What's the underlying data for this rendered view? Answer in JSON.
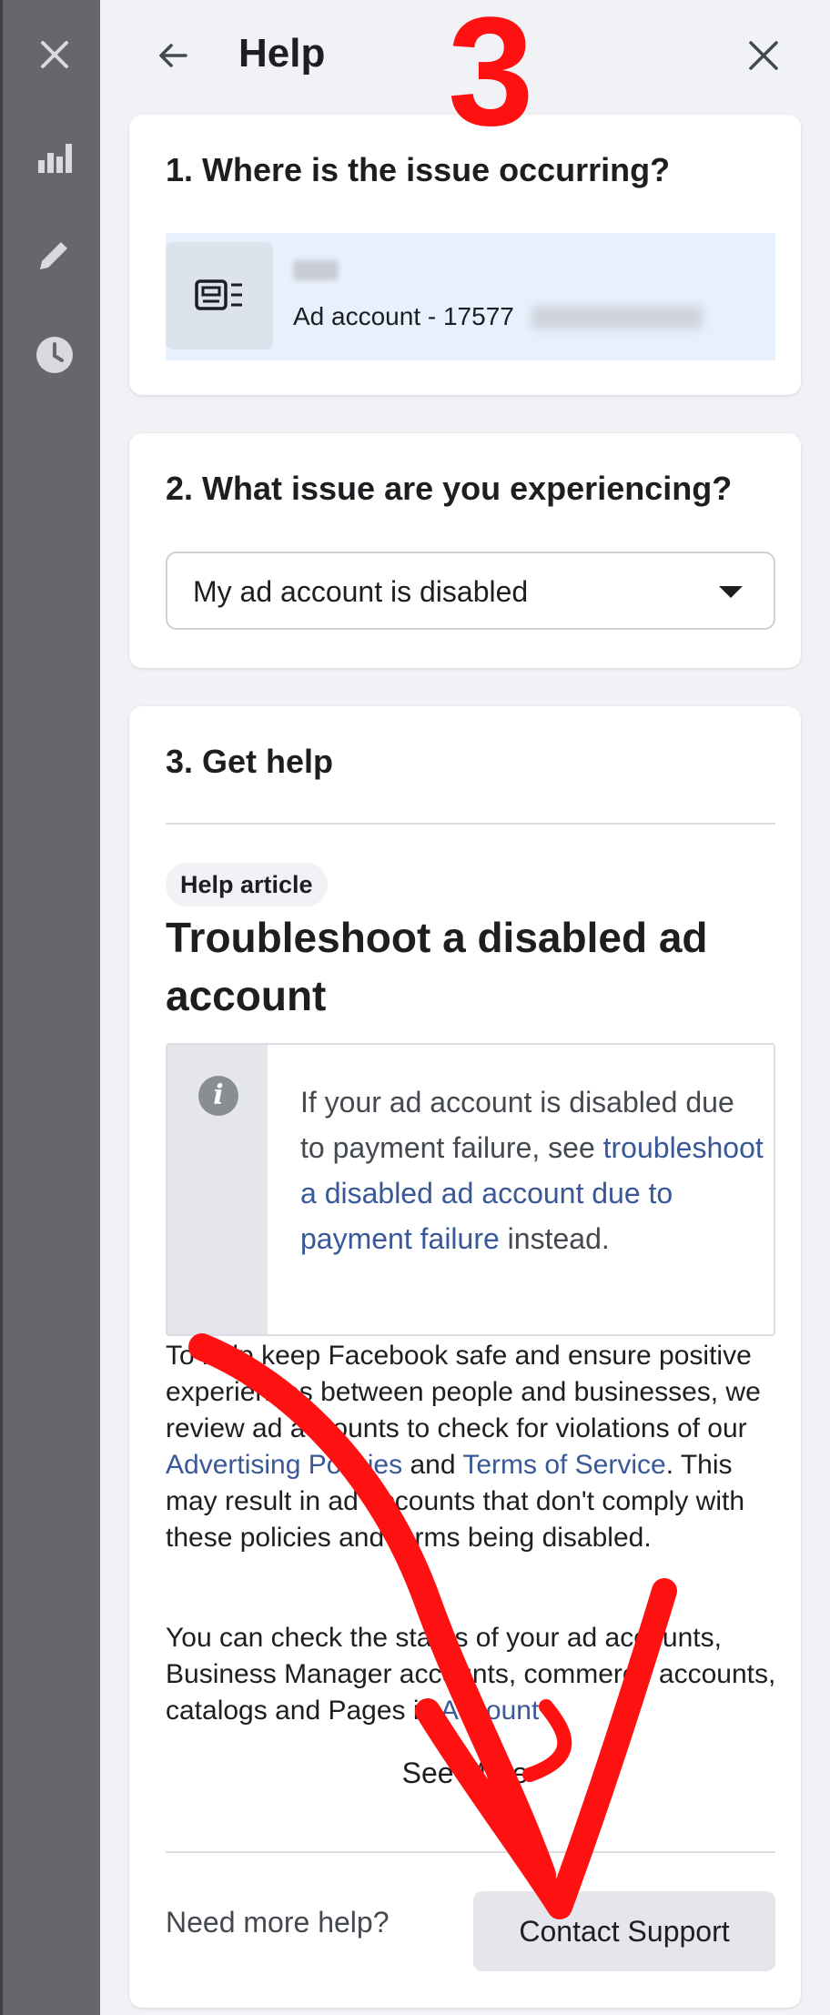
{
  "header": {
    "title": "Help",
    "step_number": "3"
  },
  "section1": {
    "heading": "1. Where is the issue occurring?",
    "account_label": "Ad account - 17577"
  },
  "section2": {
    "heading": "2. What issue are you experiencing?",
    "selected_issue": "My ad account is disabled"
  },
  "section3": {
    "heading": "3. Get help",
    "tag": "Help article",
    "article_title": "Troubleshoot a disabled ad account",
    "note": {
      "before": "If your ad account is disabled due to payment failure, see ",
      "link": "troubleshoot a disabled ad account due to payment failure",
      "after": " instead."
    },
    "para1": {
      "text1": "To help keep Facebook safe and ensure positive experiences between people and businesses, we review ad accounts to check for violations of our ",
      "link1": "Advertising Policies",
      "text2": " and ",
      "link2": "Terms of Service",
      "text3": ". This may result in ad accounts that don't comply with these policies and terms being disabled."
    },
    "para2": {
      "text": "You can check the status of your ad accounts, Business Manager accounts, commerce accounts, catalogs and Pages in ",
      "link": "Account"
    },
    "see_more": "See More",
    "need_more_help": "Need more help?",
    "contact_support": "Contact Support"
  },
  "colors": {
    "sidebar": "#65676b",
    "annotation": "#ff1111",
    "link": "#385898",
    "account_highlight": "#e7f0fd"
  },
  "icons": {
    "rail": [
      "close-icon",
      "bar-chart-icon",
      "pencil-icon",
      "clock-icon"
    ],
    "account": "ad-account-icon",
    "note": "info-icon"
  }
}
